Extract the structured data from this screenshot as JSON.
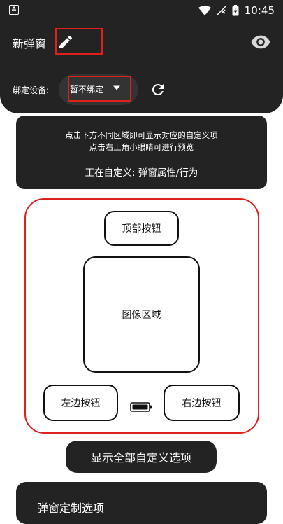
{
  "statusbar": {
    "time": "10:45",
    "app_icon_letter": "A"
  },
  "header": {
    "title": "新弹窗",
    "bind_label": "绑定设备:",
    "bind_value": "暂不绑定"
  },
  "info": {
    "line1": "点击下方不同区域即可显示对应的自定义项",
    "line2": "点击右上角小眼睛可进行预览",
    "current": "正在自定义: 弹窗属性/行为"
  },
  "preview": {
    "top_button": "顶部按钮",
    "image_area": "图像区域",
    "left_button": "左边按钮",
    "right_button": "右边按钮"
  },
  "show_all_label": "显示全部自定义选项",
  "bottom_panel_title": "弹窗定制选项",
  "colors": {
    "dark": "#232323",
    "highlight": "#e0201c"
  }
}
